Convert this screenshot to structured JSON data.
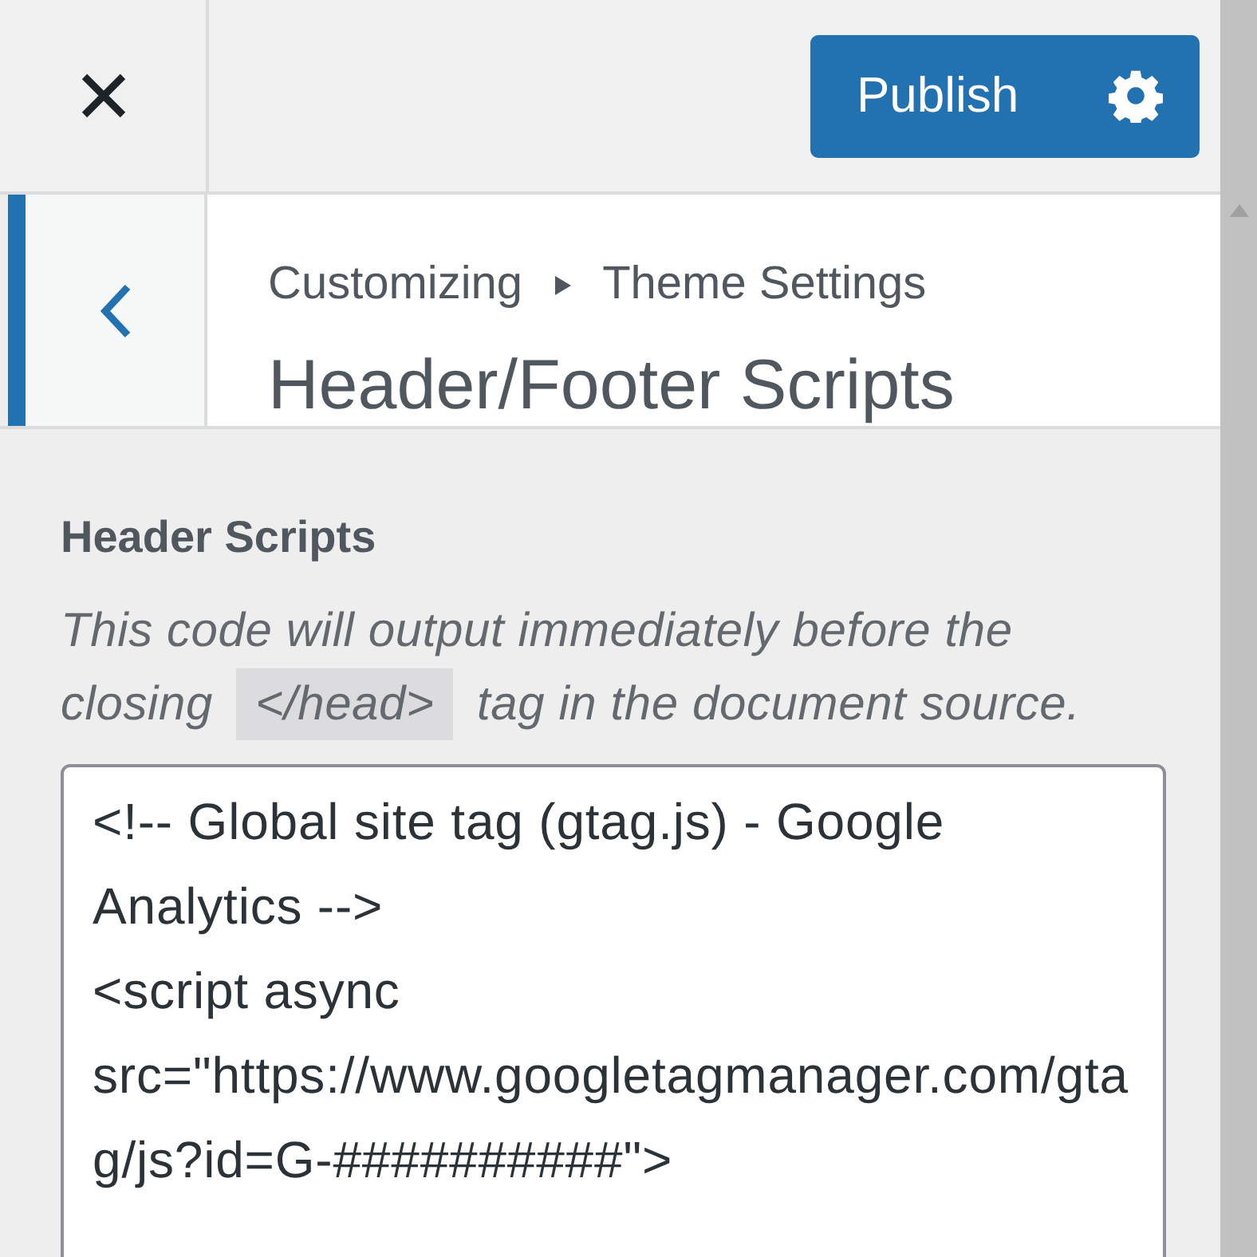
{
  "header": {
    "publish_button": "Publish"
  },
  "section": {
    "breadcrumb": [
      "Customizing",
      "Theme Settings"
    ],
    "title": "Header/Footer Scripts"
  },
  "control": {
    "label": "Header Scripts",
    "description_before": "This code will output immediately before the closing",
    "description_code": "</head>",
    "description_after": "tag in the document source.",
    "value": "<!-- Global site tag (gtag.js) - Google Analytics -->\n<script async src=\"https://www.googletagmanager.com/gtag/js?id=G-##########\">"
  }
}
